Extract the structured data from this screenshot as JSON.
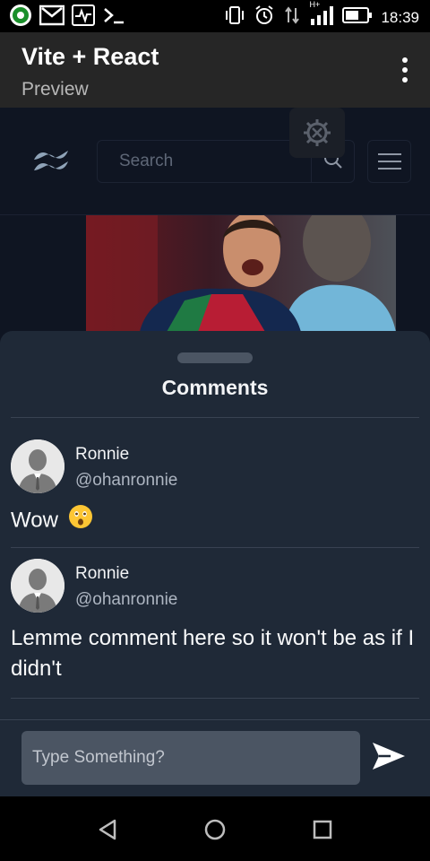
{
  "status_bar": {
    "time": "18:39",
    "icons": [
      "app-indicator-icon",
      "gmail-icon",
      "activity-icon",
      "terminal-icon",
      "vibrate-icon",
      "alarm-icon",
      "data-transfer-icon",
      "signal-icon",
      "battery-icon"
    ],
    "network_label": "H+"
  },
  "app_bar": {
    "title": "Vite + React",
    "subtitle": "Preview"
  },
  "site_nav": {
    "search_placeholder": "Search"
  },
  "comments_sheet": {
    "title": "Comments",
    "comments": [
      {
        "name": "Ronnie",
        "handle": "@ohanronnie",
        "text": "Wow",
        "emoji": "astonished-face-emoji"
      },
      {
        "name": "Ronnie",
        "handle": "@ohanronnie",
        "text": "Lemme comment here so it won't be as if I didn't"
      }
    ],
    "input_placeholder": "Type Something?"
  },
  "colors": {
    "app_bar": "#262626",
    "page_bg": "#0f1522",
    "sheet_bg": "#1f2937",
    "input_bg": "#4b5563"
  }
}
